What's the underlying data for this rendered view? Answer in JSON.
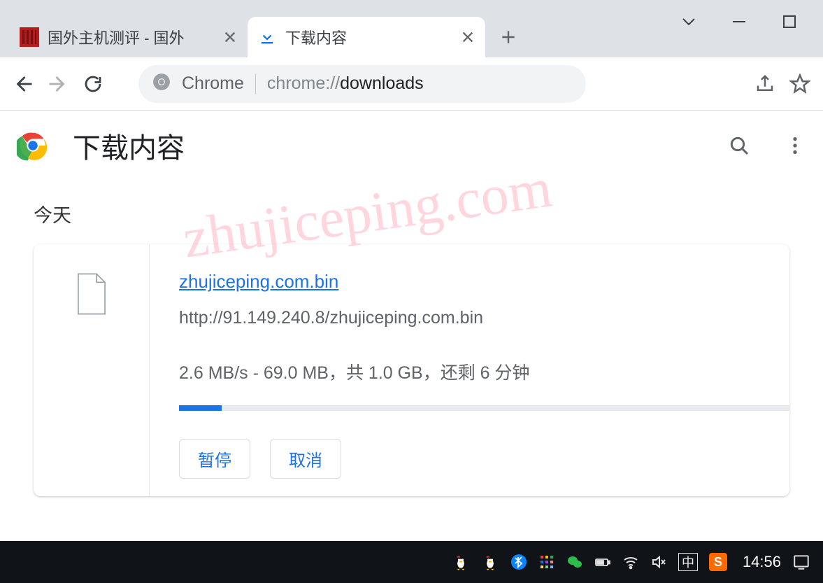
{
  "tabs": [
    {
      "title": "国外主机测评 - 国外",
      "active": false
    },
    {
      "title": "下载内容",
      "active": true
    }
  ],
  "addressbar": {
    "label": "Chrome",
    "url_prefix": "chrome://",
    "url_strong": "downloads"
  },
  "downloads": {
    "page_title": "下载内容",
    "section_label": "今天",
    "item": {
      "filename": "zhujiceping.com.bin",
      "url": "http://91.149.240.8/zhujiceping.com.bin",
      "progress_text": "2.6 MB/s - 69.0 MB，共 1.0 GB，还剩 6 分钟",
      "pause_label": "暂停",
      "cancel_label": "取消",
      "progress_percent": 7
    }
  },
  "watermark": "zhujiceping.com",
  "taskbar": {
    "ime": "中",
    "sogou": "S",
    "clock": "14:56"
  }
}
